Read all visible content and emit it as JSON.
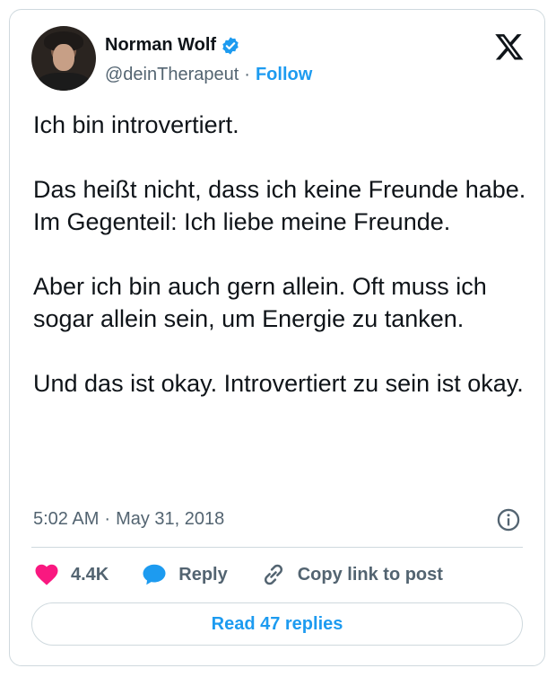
{
  "author": {
    "name": "Norman Wolf",
    "handle": "@deinTherapeut",
    "separator": "·",
    "follow_label": "Follow",
    "verified": true
  },
  "tweet": {
    "text": "Ich bin introvertiert.\n\nDas heißt nicht, dass ich keine Freunde habe. Im Gegenteil: Ich liebe meine Freunde.\n\nAber ich bin auch gern allein. Oft muss ich sogar allein sein, um Energie zu tanken.\n\nUnd das ist okay. Introvertiert zu sein ist okay.",
    "time": "5:02 AM",
    "separator": "·",
    "date": "May 31, 2018"
  },
  "actions": {
    "like_count": "4.4K",
    "reply_label": "Reply",
    "copy_label": "Copy link to post"
  },
  "read_replies_label": "Read 47 replies",
  "colors": {
    "accent": "#1d9bf0",
    "like": "#f91880",
    "text": "#0f1419",
    "muted": "#536471",
    "border": "#cfd9de"
  }
}
